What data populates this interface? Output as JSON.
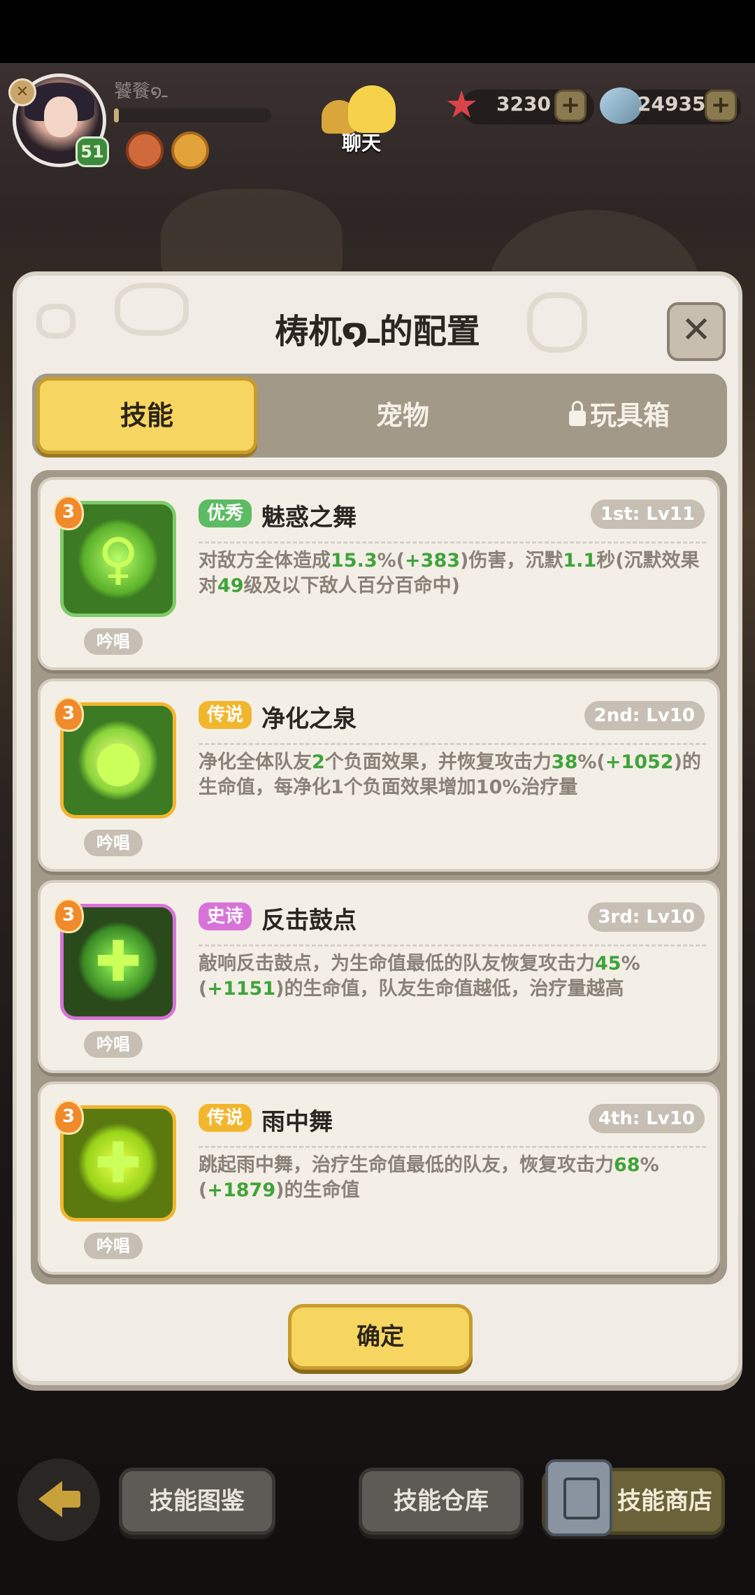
{
  "hud": {
    "player_name": "饕餮໑ـ",
    "level": "51",
    "xp_fraction": 0.03,
    "chat_label": "聊天",
    "starfish_count": "3230",
    "shell_count": "249359",
    "plus_symbol": "+"
  },
  "dialog": {
    "title": "梼杌໑ـ的配置",
    "close_symbol": "✕",
    "tabs": [
      {
        "label": "技能",
        "active": true,
        "locked": false
      },
      {
        "label": "宠物",
        "active": false,
        "locked": false
      },
      {
        "label": "玩具箱",
        "active": false,
        "locked": true
      }
    ],
    "skills": [
      {
        "rank": "3",
        "chant": "吟唱",
        "quality": "优秀",
        "quality_color": "#5dbb63",
        "name": "魅惑之舞",
        "slot": "1st: Lv11",
        "icon": "dancer-silhouette-icon",
        "desc": [
          {
            "t": "对敌方全体造成"
          },
          {
            "t": "15.3",
            "h": true
          },
          {
            "t": "%("
          },
          {
            "t": "+383",
            "h": true
          },
          {
            "t": ")伤害，沉默"
          },
          {
            "t": "1.1",
            "h": true
          },
          {
            "t": "秒(沉默效果对"
          },
          {
            "t": "49",
            "h": true
          },
          {
            "t": "级及以下敌人百分百命中)"
          }
        ]
      },
      {
        "rank": "3",
        "chant": "吟唱",
        "quality": "传说",
        "quality_color": "#f2b62e",
        "name": "净化之泉",
        "slot": "2nd: Lv10",
        "icon": "water-drop-icon",
        "desc": [
          {
            "t": "净化全体队友"
          },
          {
            "t": "2",
            "h": true
          },
          {
            "t": "个负面效果，并恢复攻击力"
          },
          {
            "t": "38",
            "h": true
          },
          {
            "t": "%("
          },
          {
            "t": "+1052",
            "h": true
          },
          {
            "t": ")的生命值，每净化1个负面效果增加10%治疗量"
          }
        ]
      },
      {
        "rank": "3",
        "chant": "吟唱",
        "quality": "史诗",
        "quality_color": "#d773d8",
        "name": "反击鼓点",
        "slot": "3rd: Lv10",
        "icon": "drum-cross-icon",
        "desc": [
          {
            "t": "敲响反击鼓点，为生命值最低的队友恢复攻击力"
          },
          {
            "t": "45",
            "h": true
          },
          {
            "t": "%("
          },
          {
            "t": "+1151",
            "h": true
          },
          {
            "t": ")的生命值，队友生命值越低，治疗量越高"
          }
        ]
      },
      {
        "rank": "3",
        "chant": "吟唱",
        "quality": "传说",
        "quality_color": "#f2b62e",
        "name": "雨中舞",
        "slot": "4th: Lv10",
        "icon": "rain-dance-icon",
        "desc": [
          {
            "t": "跳起雨中舞，治疗生命值最低的队友，恢复攻击力"
          },
          {
            "t": "68",
            "h": true
          },
          {
            "t": "%("
          },
          {
            "t": "+1879",
            "h": true
          },
          {
            "t": ")的生命值"
          }
        ]
      }
    ],
    "confirm_label": "确定"
  },
  "bottom_bar": {
    "back_icon": "back-arrow-icon",
    "codex_label": "技能图鉴",
    "warehouse_label": "技能仓库",
    "shop_label": "技能商店"
  }
}
